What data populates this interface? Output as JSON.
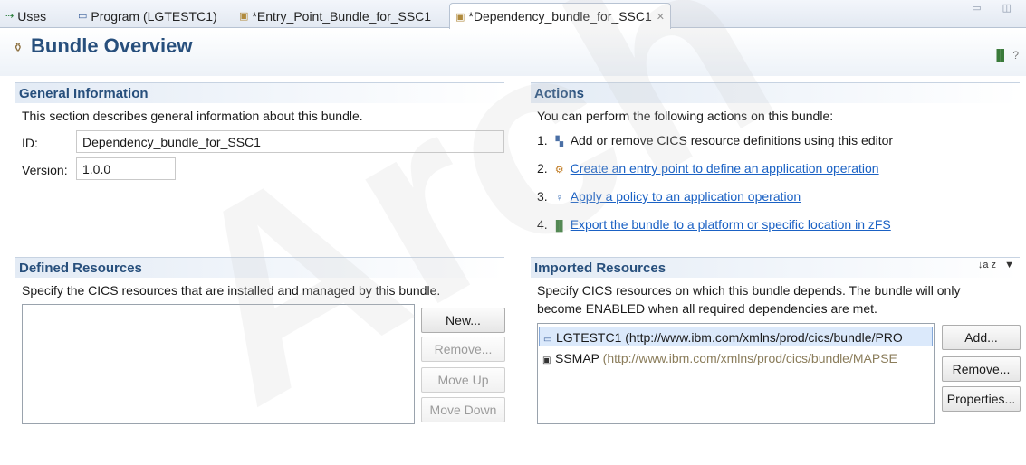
{
  "tabs": [
    {
      "icon": "⇢",
      "label": "Uses"
    },
    {
      "icon": "▭",
      "label": "Program (LGTESTC1)"
    },
    {
      "icon": "▣",
      "label": "*Entry_Point_Bundle_for_SSC1"
    },
    {
      "icon": "▣",
      "label": "*Dependency_bundle_for_SSC1",
      "close": "✕"
    }
  ],
  "window_controls": "▭ ◫",
  "header": {
    "title": "Bundle Overview",
    "right_icon": "▐▌",
    "help": "?"
  },
  "general": {
    "title": "General Information",
    "description": "This section describes general information about this bundle.",
    "id_label": "ID:",
    "id_value": "Dependency_bundle_for_SSC1",
    "version_label": "Version:",
    "version_value": "1.0.0"
  },
  "actions": {
    "title": "Actions",
    "description": "You can perform the following actions on this bundle:",
    "items": [
      {
        "num": "1.",
        "text": "Add or remove CICS resource definitions using this editor",
        "link": false
      },
      {
        "num": "2.",
        "text": "Create an entry point to define an application operation",
        "link": true
      },
      {
        "num": "3.",
        "text": "Apply a policy to an application operation",
        "link": true
      },
      {
        "num": "4.",
        "text": "Export the bundle to a platform or specific location in zFS",
        "link": true
      }
    ]
  },
  "defined": {
    "title": "Defined Resources",
    "description": "Specify the CICS resources that are installed and managed by this bundle.",
    "buttons": {
      "new": "New...",
      "remove": "Remove...",
      "move_up": "Move Up",
      "move_down": "Move Down"
    }
  },
  "imported": {
    "title": "Imported Resources",
    "sort_icon": "↓a z",
    "menu_icon": "▼",
    "description_line1": "Specify CICS resources on which this bundle depends. The bundle will only",
    "description_line2": "become ENABLED when all required dependencies are met.",
    "rows": [
      {
        "name": "LGTESTC1",
        "uri": "(http://www.ibm.com/xmlns/prod/cics/bundle/PRO"
      },
      {
        "name": "SSMAP",
        "uri": "(http://www.ibm.com/xmlns/prod/cics/bundle/MAPSE"
      }
    ],
    "buttons": {
      "add": "Add...",
      "remove": "Remove...",
      "properties": "Properties..."
    }
  },
  "watermark": "Arch"
}
